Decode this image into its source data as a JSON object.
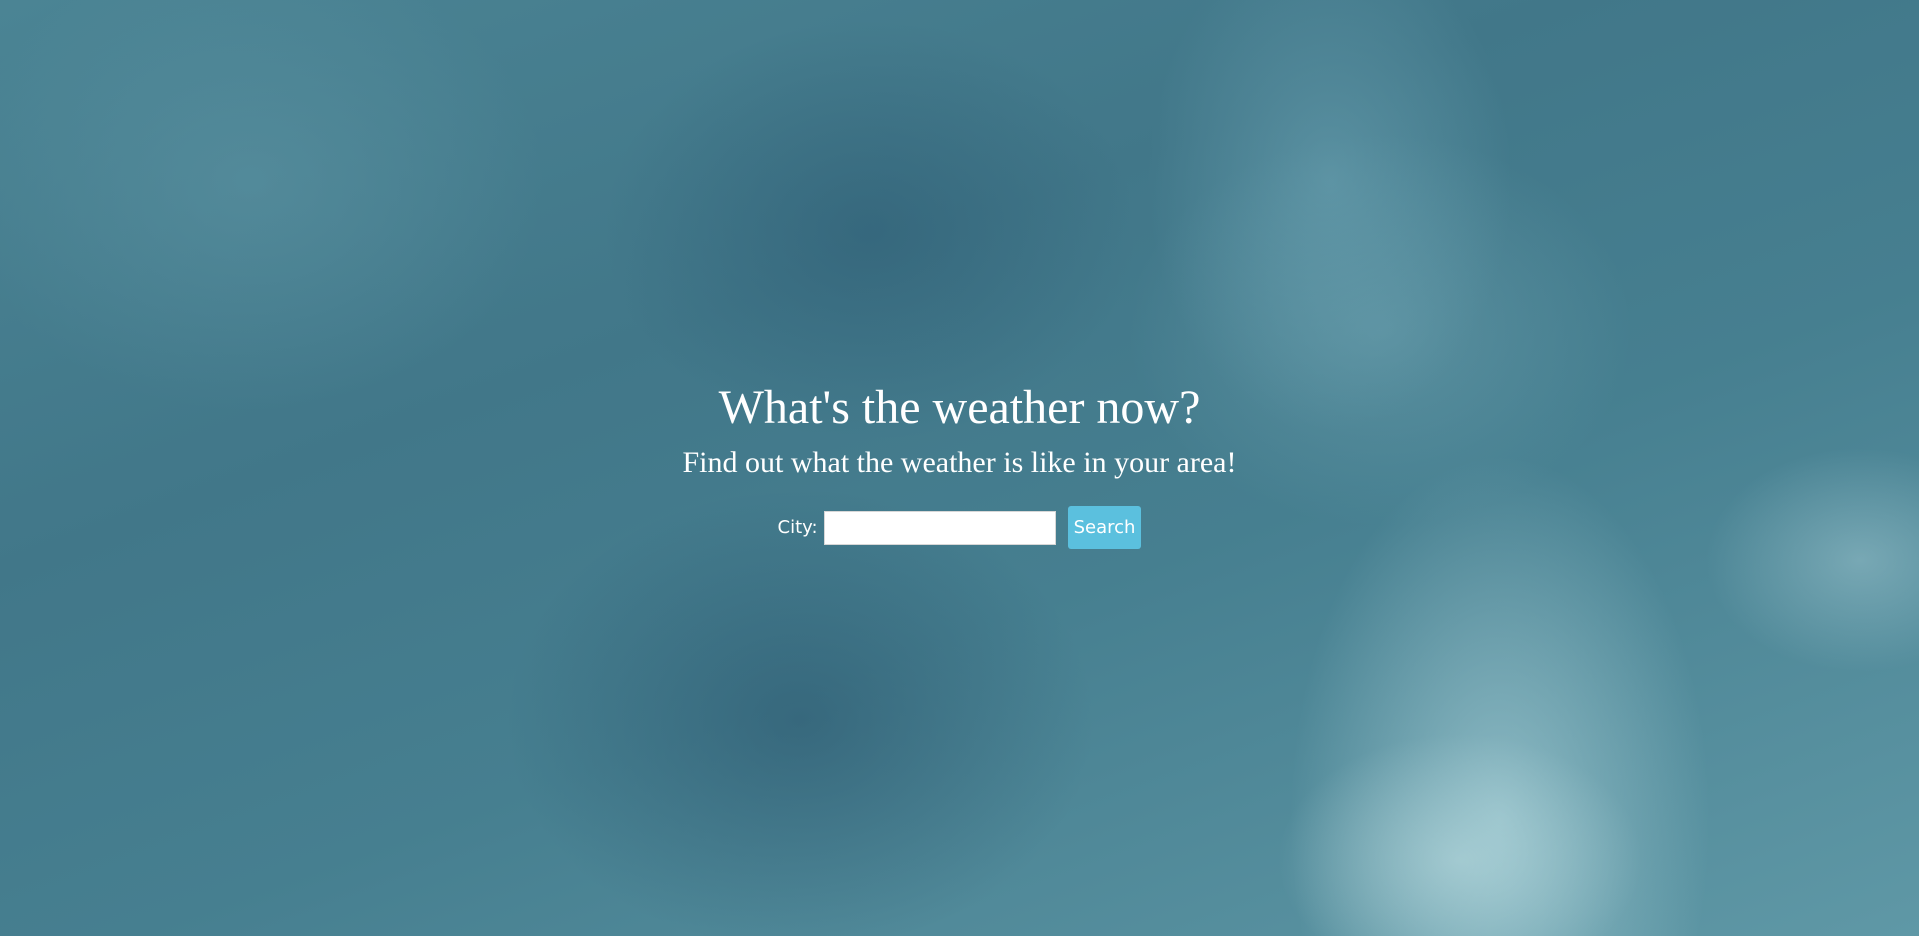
{
  "page": {
    "title": "What's the weather now?",
    "subtitle": "Find out what the weather is like in your area!"
  },
  "form": {
    "city_label": "City:",
    "city_value": "",
    "city_placeholder": "",
    "search_label": "Search"
  },
  "colors": {
    "button": "#5bc0de",
    "text": "#ffffff",
    "sky": "#457c8e"
  }
}
